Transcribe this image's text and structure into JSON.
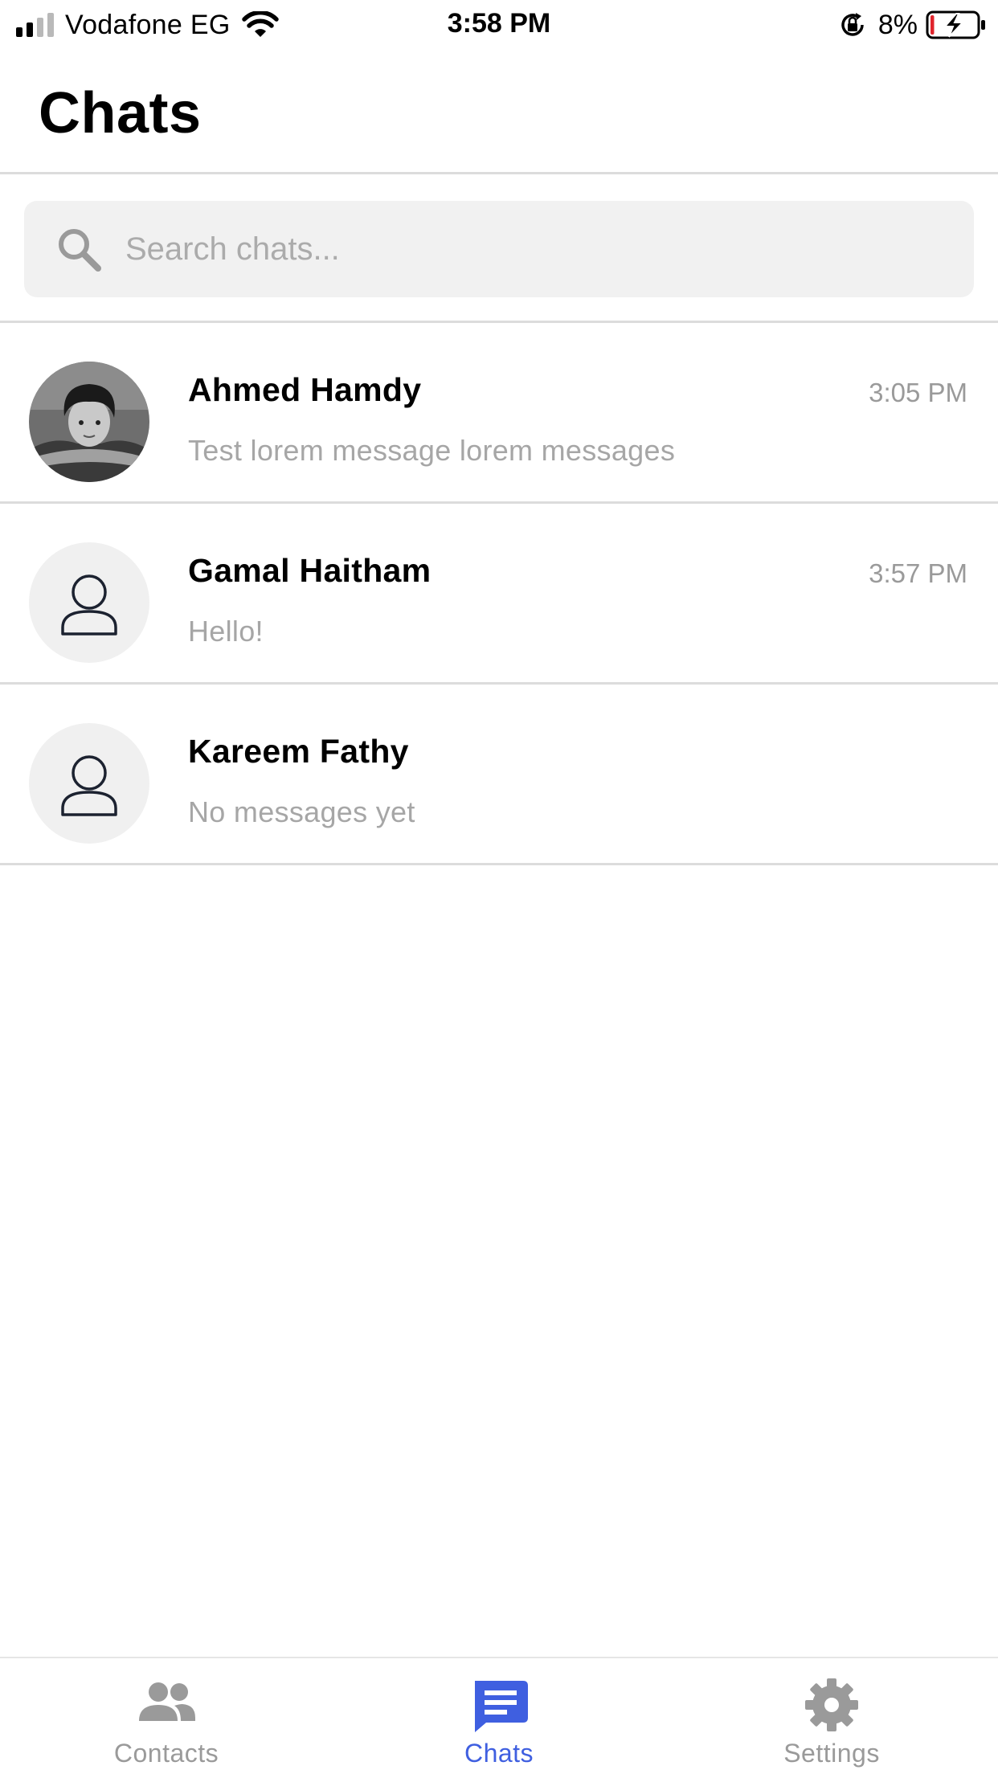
{
  "status_bar": {
    "carrier": "Vodafone EG",
    "time": "3:58 PM",
    "battery_percent": "8%",
    "signal_bars_active": 2,
    "signal_bars_total": 4,
    "battery_level": 0.08,
    "battery_charging": true,
    "icons": [
      "signal-icon",
      "wifi-icon",
      "rotation-lock-icon",
      "battery-charging-icon"
    ]
  },
  "header": {
    "title": "Chats"
  },
  "search": {
    "placeholder": "Search chats..."
  },
  "chats": [
    {
      "name": "Ahmed Hamdy",
      "time": "3:05 PM",
      "preview": "Test lorem message lorem messages",
      "avatar": "photo"
    },
    {
      "name": "Gamal Haitham",
      "time": "3:57 PM",
      "preview": "Hello!",
      "avatar": "placeholder-person-icon"
    },
    {
      "name": "Kareem Fathy",
      "time": "",
      "preview": "No messages yet",
      "avatar": "placeholder-person-icon"
    }
  ],
  "tab_bar": {
    "tabs": [
      {
        "label": "Contacts",
        "icon": "people-icon",
        "active": false
      },
      {
        "label": "Chats",
        "icon": "chat-bubble-icon",
        "active": true
      },
      {
        "label": "Settings",
        "icon": "gear-icon",
        "active": false
      }
    ]
  },
  "colors": {
    "accent": "#3f5fe0",
    "inactive_tab": "#9a9a9a",
    "divider": "#dcdcdc",
    "search_bg": "#f1f1f1",
    "battery_low": "#e0242c"
  }
}
